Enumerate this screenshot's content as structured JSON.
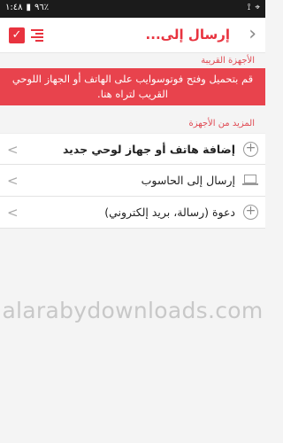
{
  "status_bar": {
    "time": "١:٤٨",
    "battery": "٩٦٪",
    "battery_label": "▮",
    "wifi": "⟟",
    "location": "⌖"
  },
  "app_bar": {
    "title": "إرسال إلى...",
    "checkbox_glyph": "✓",
    "back_glyph": "›"
  },
  "sections": {
    "nearby": "الأجهزة القريبة",
    "more": "المزيد من الأجهزة"
  },
  "banner": {
    "text": "قم بتحميل وفتح فوتوسوايب على الهاتف أو الجهاز اللوحي القريب لتراه هنا."
  },
  "items": [
    {
      "label": "إضافة هاتف أو جهاز لوحي جديد",
      "icon": "add-circle-icon",
      "chevron": "<"
    },
    {
      "label": "إرسال إلى الحاسوب",
      "icon": "laptop-icon",
      "chevron": "<"
    },
    {
      "label": "دعوة (رسالة، بريد إلكتروني)",
      "icon": "add-circle-icon",
      "chevron": "<"
    }
  ],
  "icons": {
    "plus": "+"
  },
  "colors": {
    "accent": "#e8333f",
    "banner": "#e8434d",
    "status_bar": "#1b1b1b"
  },
  "watermark": "alarabydownloads.com"
}
